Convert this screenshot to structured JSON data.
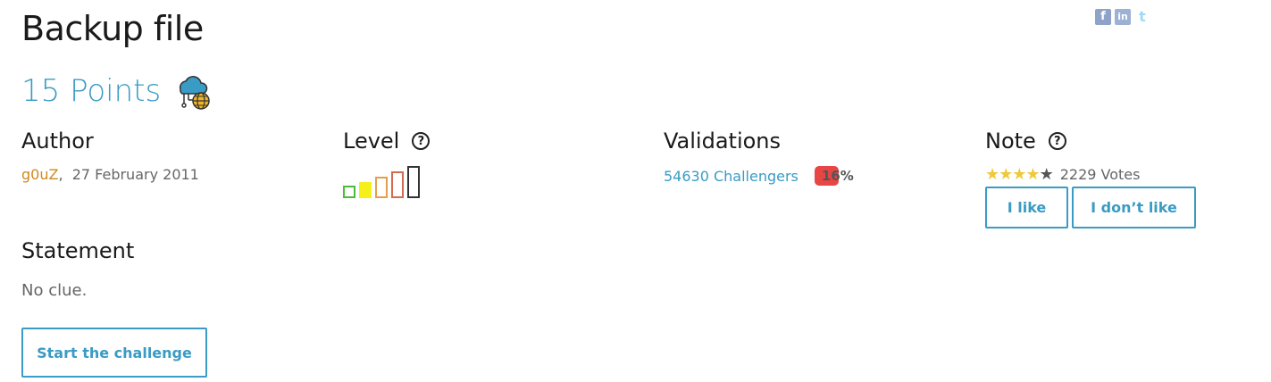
{
  "challenge": {
    "title": "Backup file",
    "points": "15 Points",
    "category_icon": "cloud-web-icon"
  },
  "share": {
    "facebook_icon": "f",
    "linkedin_icon": "in",
    "twitter_icon": "t"
  },
  "author": {
    "heading": "Author",
    "name": "g0uZ",
    "separator": ",",
    "date": "27 February 2011"
  },
  "level": {
    "heading": "Level",
    "help": "?",
    "current_level": 2,
    "max_level": 5,
    "colors": [
      "#4cbb3a",
      "#f5f01a",
      "#e89d4a",
      "#d46a4e",
      "#333333"
    ]
  },
  "validations": {
    "heading": "Validations",
    "challengers": "54630 Challengers",
    "percent": "16%",
    "badge_color": "#e84545"
  },
  "note": {
    "heading": "Note",
    "help": "?",
    "stars_filled": 4,
    "stars_total": 5,
    "votes": "2229 Votes",
    "like_label": "I like",
    "dislike_label": "I don’t like"
  },
  "statement": {
    "heading": "Statement",
    "text": "No clue."
  },
  "actions": {
    "start_label": "Start the challenge"
  },
  "colors": {
    "accent": "#3a9bc4",
    "author": "#d0891e"
  }
}
